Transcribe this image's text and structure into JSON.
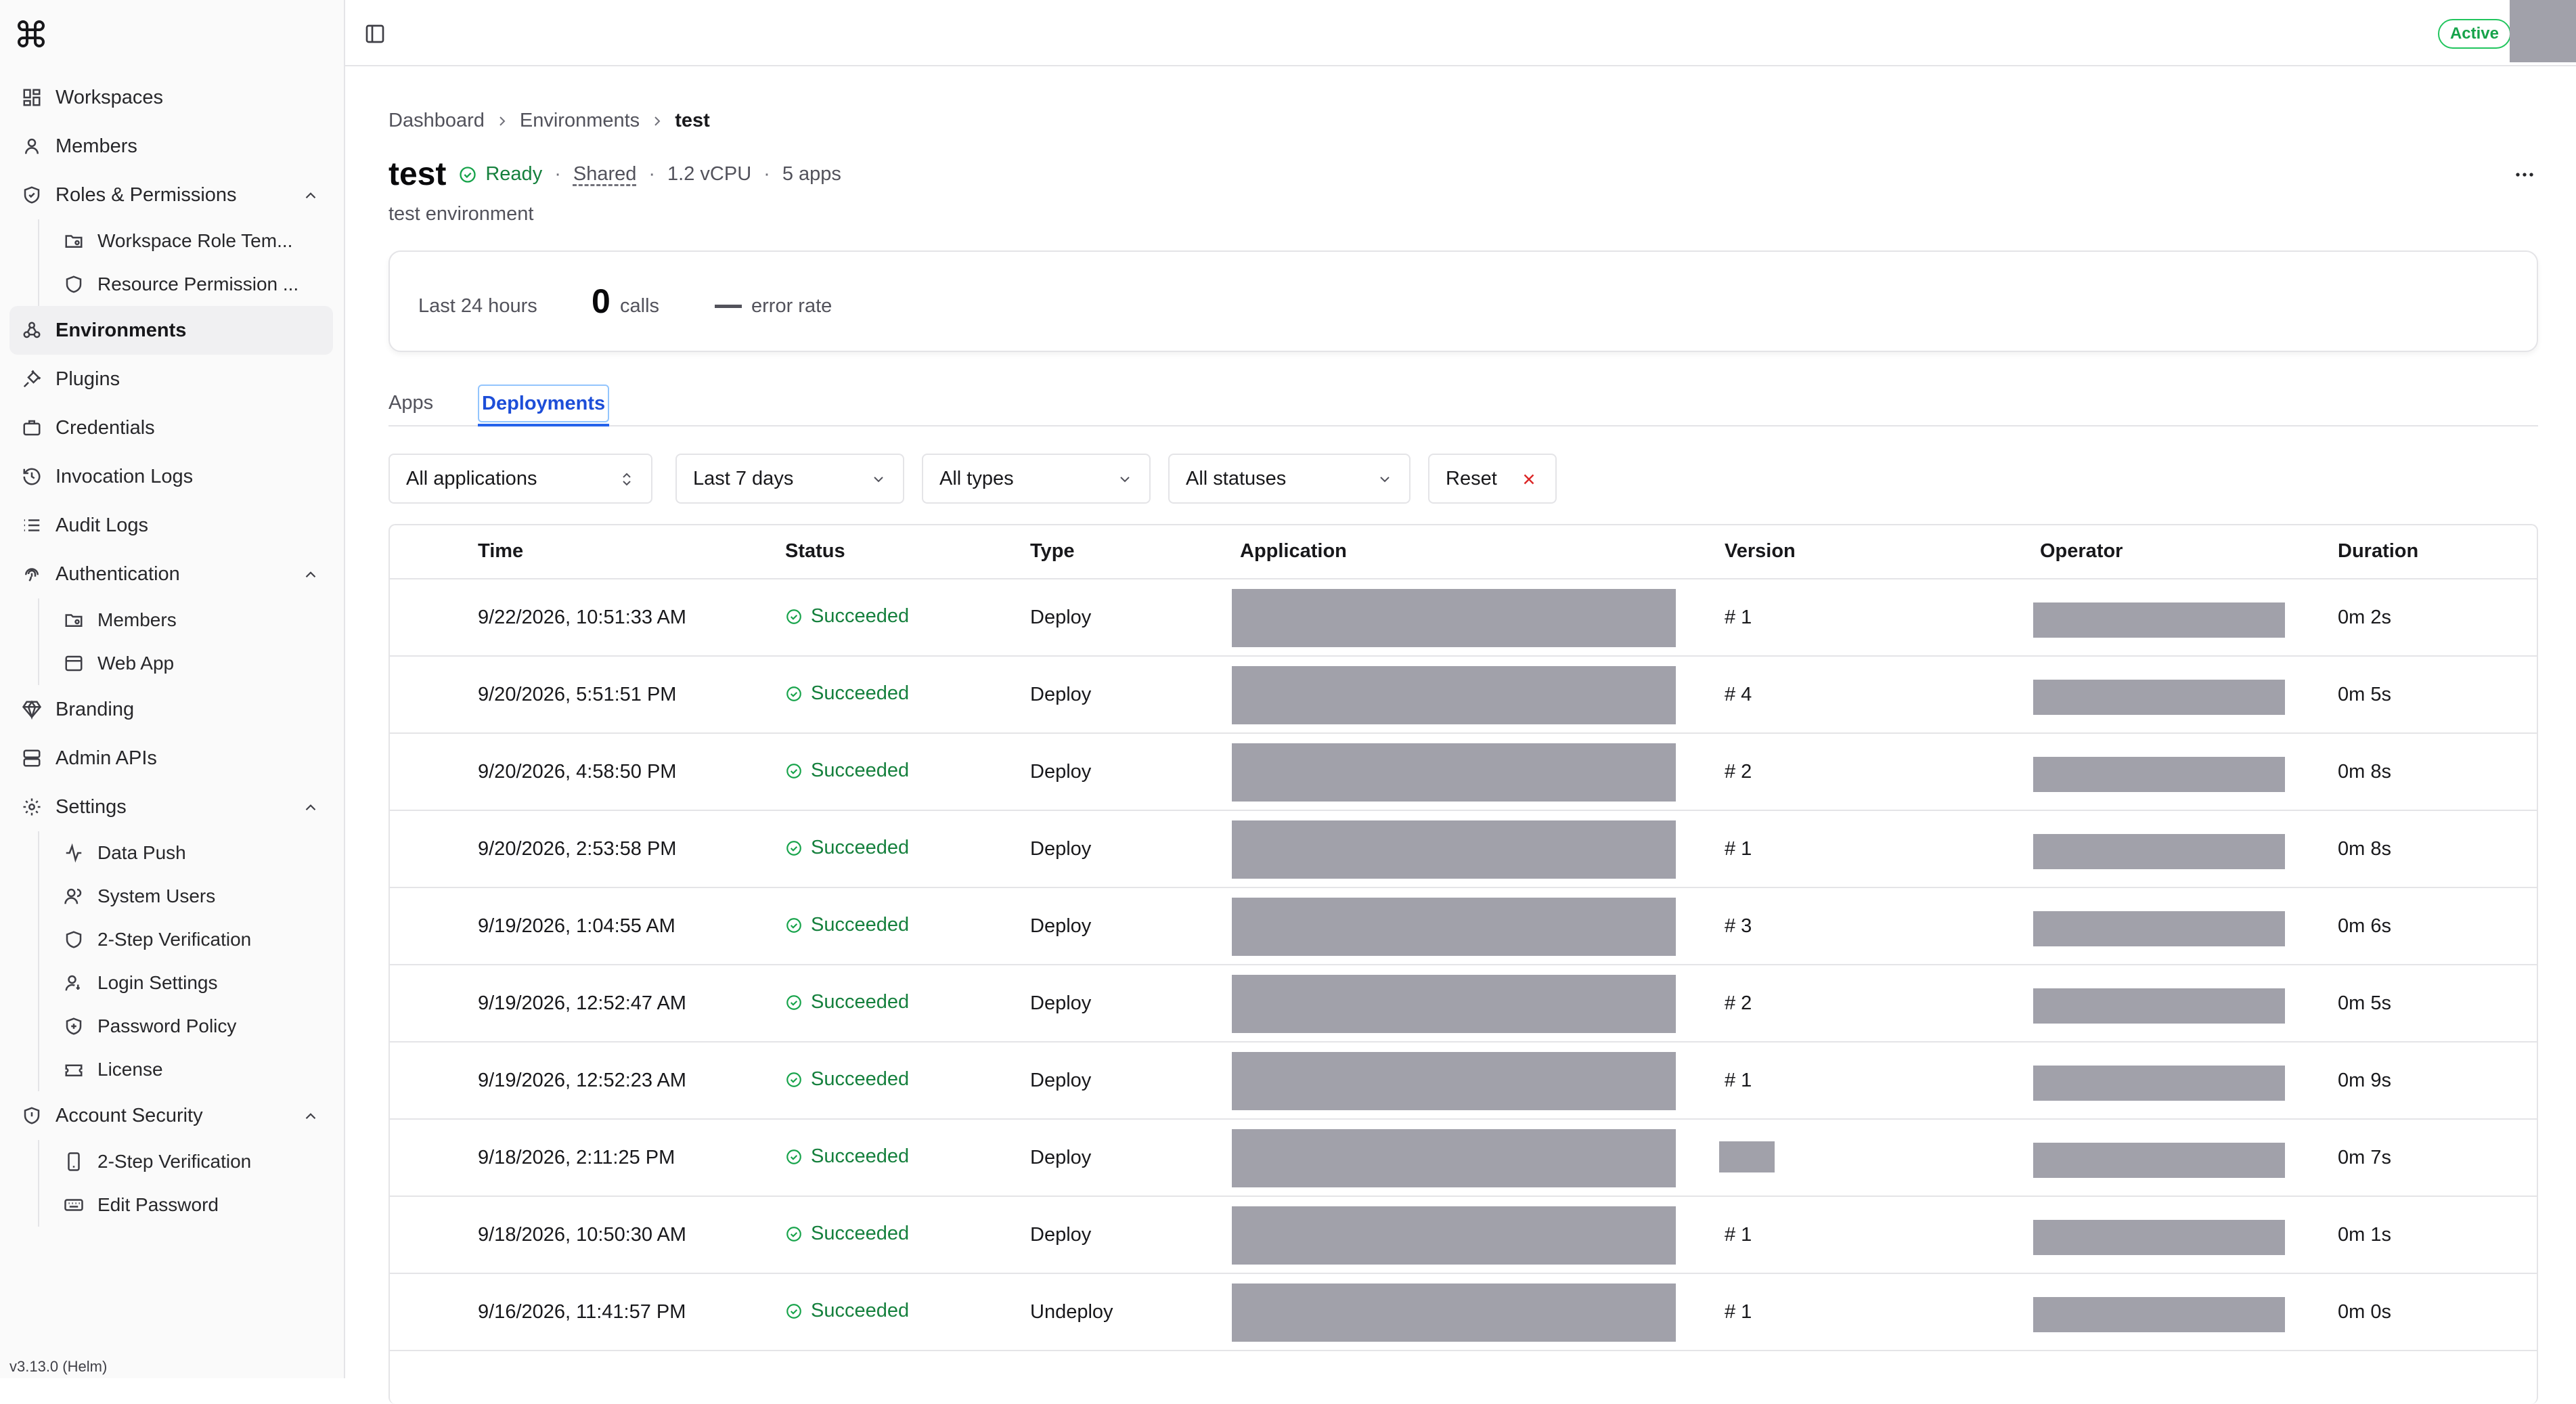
{
  "sidebar": {
    "items": [
      {
        "label": "Workspaces"
      },
      {
        "label": "Members"
      },
      {
        "label": "Roles & Permissions"
      },
      {
        "label": "Workspace Role Tem..."
      },
      {
        "label": "Resource Permission ..."
      },
      {
        "label": "Environments"
      },
      {
        "label": "Plugins"
      },
      {
        "label": "Credentials"
      },
      {
        "label": "Invocation Logs"
      },
      {
        "label": "Audit Logs"
      },
      {
        "label": "Authentication"
      },
      {
        "label": "Members"
      },
      {
        "label": "Web App"
      },
      {
        "label": "Branding"
      },
      {
        "label": "Admin APIs"
      },
      {
        "label": "Settings"
      },
      {
        "label": "Data Push"
      },
      {
        "label": "System Users"
      },
      {
        "label": "2-Step Verification"
      },
      {
        "label": "Login Settings"
      },
      {
        "label": "Password Policy"
      },
      {
        "label": "License"
      },
      {
        "label": "Account Security"
      },
      {
        "label": "2-Step Verification"
      },
      {
        "label": "Edit Password"
      }
    ],
    "version": "v3.13.0 (Helm)"
  },
  "topbar": {
    "status_badge": "Active"
  },
  "breadcrumb": [
    "Dashboard",
    "Environments",
    "test"
  ],
  "environment": {
    "name": "test",
    "status": "Ready",
    "mode": "Shared",
    "vcpu": "1.2 vCPU",
    "apps": "5 apps",
    "description": "test environment"
  },
  "stats": {
    "period": "Last 24 hours",
    "calls": "0",
    "calls_unit": "calls",
    "error_rate_label": "error rate"
  },
  "tabs": [
    "Apps",
    "Deployments"
  ],
  "filters": {
    "application": "All applications",
    "range": "Last 7 days",
    "type": "All types",
    "status": "All statuses",
    "reset": "Reset"
  },
  "table": {
    "columns": [
      "Time",
      "Status",
      "Type",
      "Application",
      "Version",
      "Operator",
      "Duration"
    ],
    "rows": [
      {
        "time": "9/22/2026, 10:51:33 AM",
        "status": "Succeeded",
        "type": "Deploy",
        "version": "# 1",
        "duration": "0m 2s"
      },
      {
        "time": "9/20/2026, 5:51:51 PM",
        "status": "Succeeded",
        "type": "Deploy",
        "version": "# 4",
        "duration": "0m 5s"
      },
      {
        "time": "9/20/2026, 4:58:50 PM",
        "status": "Succeeded",
        "type": "Deploy",
        "version": "# 2",
        "duration": "0m 8s"
      },
      {
        "time": "9/20/2026, 2:53:58 PM",
        "status": "Succeeded",
        "type": "Deploy",
        "version": "# 1",
        "duration": "0m 8s"
      },
      {
        "time": "9/19/2026, 1:04:55 AM",
        "status": "Succeeded",
        "type": "Deploy",
        "version": "# 3",
        "duration": "0m 6s"
      },
      {
        "time": "9/19/2026, 12:52:47 AM",
        "status": "Succeeded",
        "type": "Deploy",
        "version": "# 2",
        "duration": "0m 5s"
      },
      {
        "time": "9/19/2026, 12:52:23 AM",
        "status": "Succeeded",
        "type": "Deploy",
        "version": "# 1",
        "duration": "0m 9s"
      },
      {
        "time": "9/18/2026, 2:11:25 PM",
        "status": "Succeeded",
        "type": "Deploy",
        "version": "",
        "duration": "0m 7s"
      },
      {
        "time": "9/18/2026, 10:50:30 AM",
        "status": "Succeeded",
        "type": "Deploy",
        "version": "# 1",
        "duration": "0m 1s"
      },
      {
        "time": "9/16/2026, 11:41:57 PM",
        "status": "Succeeded",
        "type": "Undeploy",
        "version": "# 1",
        "duration": "0m 0s"
      }
    ]
  }
}
